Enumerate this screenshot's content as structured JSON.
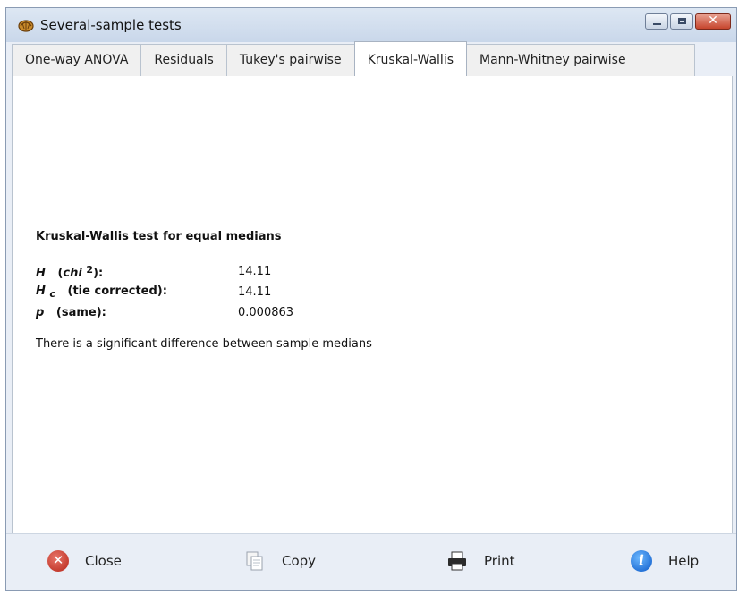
{
  "window": {
    "title": "Several-sample tests"
  },
  "tabs": [
    {
      "label": "One-way ANOVA",
      "active": false
    },
    {
      "label": "Residuals",
      "active": false
    },
    {
      "label": "Tukey's pairwise",
      "active": false
    },
    {
      "label": "Kruskal-Wallis",
      "active": true
    },
    {
      "label": "Mann-Whitney pairwise",
      "active": false
    }
  ],
  "result": {
    "heading": "Kruskal-Wallis test for equal medians",
    "rows": [
      {
        "sym": "H",
        "sup": "2",
        "mid": "chi",
        "rest": "):",
        "value": "14.11"
      },
      {
        "sym": "H",
        "sub": "c",
        "rest": "(tie corrected):",
        "value": "14.11"
      },
      {
        "sym": "p",
        "rest": "(same):",
        "value": "0.000863"
      }
    ],
    "conclusion": "There is a significant difference between sample medians"
  },
  "buttons": {
    "close": "Close",
    "copy": "Copy",
    "print": "Print",
    "help": "Help"
  },
  "colors": {
    "title_bg": "#c9d7ea",
    "close_red": "#c6452d",
    "help_blue": "#0a58c8"
  }
}
